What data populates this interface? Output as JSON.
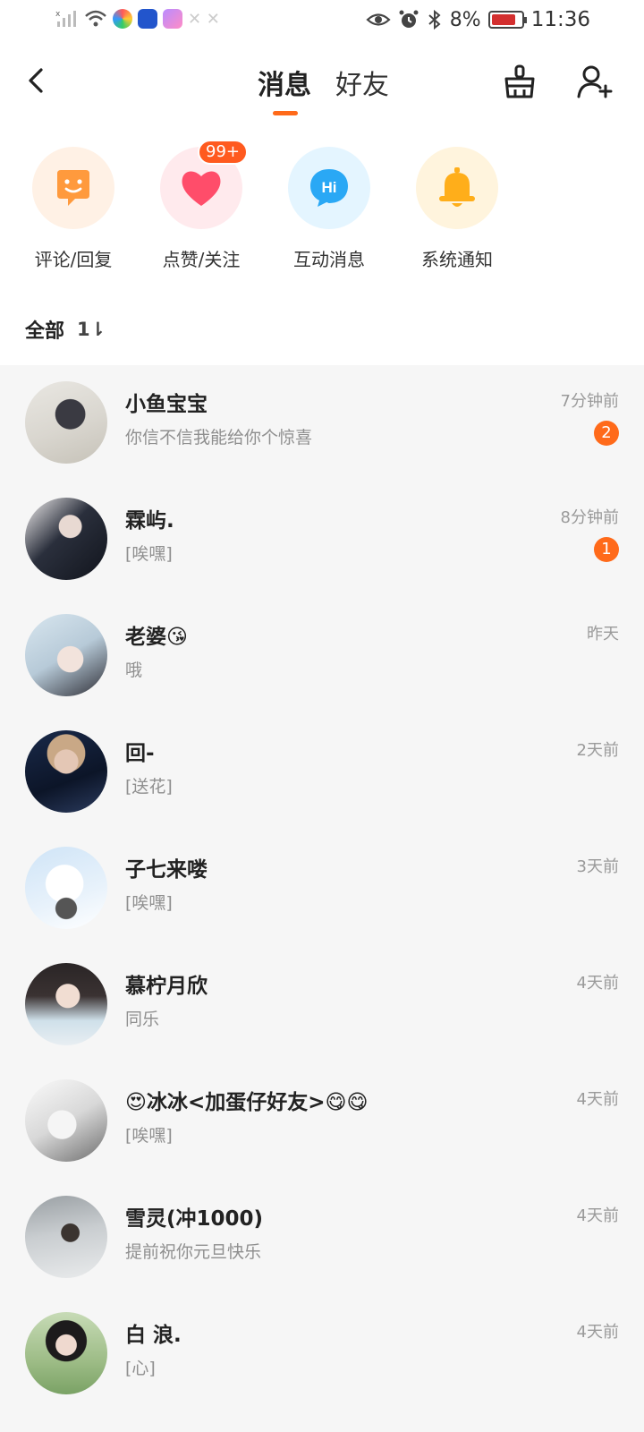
{
  "status_bar": {
    "battery": "8%",
    "time": "11:36"
  },
  "header": {
    "tabs": [
      {
        "label": "消息",
        "active": true
      },
      {
        "label": "好友",
        "active": false
      }
    ]
  },
  "categories": [
    {
      "label": "评论/回复",
      "icon": "speech-face-icon",
      "color": "#ff9a3d",
      "bg": "#fff1e5"
    },
    {
      "label": "点赞/关注",
      "icon": "heart-icon",
      "color": "#ff4d6a",
      "bg": "#ffeaed",
      "badge": "99+"
    },
    {
      "label": "互动消息",
      "icon": "hi-bubble-icon",
      "color": "#2aa8f5",
      "bg": "#e4f5ff",
      "text": "Hi"
    },
    {
      "label": "系统通知",
      "icon": "bell-icon",
      "color": "#ffae1a",
      "bg": "#fff4dd"
    }
  ],
  "sort": {
    "label": "全部",
    "icon": "sort-icon",
    "glyph": "1⇂"
  },
  "conversations": [
    {
      "name": "小鱼宝宝",
      "preview": "你信不信我能给你个惊喜",
      "time": "7分钟前",
      "unread": "2"
    },
    {
      "name": "霖屿.",
      "preview": "[唉嘿]",
      "time": "8分钟前",
      "unread": "1"
    },
    {
      "name": "老婆😘",
      "preview": "哦",
      "time": "昨天"
    },
    {
      "name": "回-",
      "preview": "[送花]",
      "time": "2天前"
    },
    {
      "name": "子七来喽",
      "preview": "[唉嘿]",
      "time": "3天前"
    },
    {
      "name": "慕柠月欣",
      "preview": "同乐",
      "time": "4天前"
    },
    {
      "name": "😍冰冰<加蛋仔好友>😋😋",
      "preview": "[唉嘿]",
      "time": "4天前"
    },
    {
      "name": "雪灵(冲1000)",
      "preview": "提前祝你元旦快乐",
      "time": "4天前"
    },
    {
      "name": "白 浪.",
      "preview": "[心]",
      "time": "4天前"
    }
  ],
  "colors": {
    "accent": "#ff6a1a",
    "list_bg": "#f6f6f6"
  }
}
